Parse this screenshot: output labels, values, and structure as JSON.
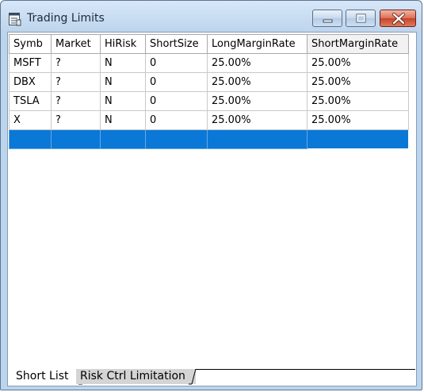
{
  "window": {
    "title": "Trading Limits",
    "icon": "spreadsheet-icon"
  },
  "controls": {
    "minimize": "minimize-icon",
    "maximize": "maximize-icon",
    "close": "close-icon"
  },
  "grid": {
    "columns": [
      "Symb",
      "Market",
      "HiRisk",
      "ShortSize",
      "LongMarginRate",
      "ShortMarginRate"
    ],
    "rows": [
      [
        "MSFT",
        "?",
        "N",
        "0",
        "25.00%",
        "25.00%"
      ],
      [
        "DBX",
        "?",
        "N",
        "0",
        "25.00%",
        "25.00%"
      ],
      [
        "TSLA",
        "?",
        "N",
        "0",
        "25.00%",
        "25.00%"
      ],
      [
        "X",
        "?",
        "N",
        "0",
        "25.00%",
        "25.00%"
      ]
    ],
    "selection_color": "#0a78d7"
  },
  "tabs": [
    {
      "label": "Short List",
      "active": true
    },
    {
      "label": "Risk Ctrl Limitation",
      "active": false
    }
  ]
}
